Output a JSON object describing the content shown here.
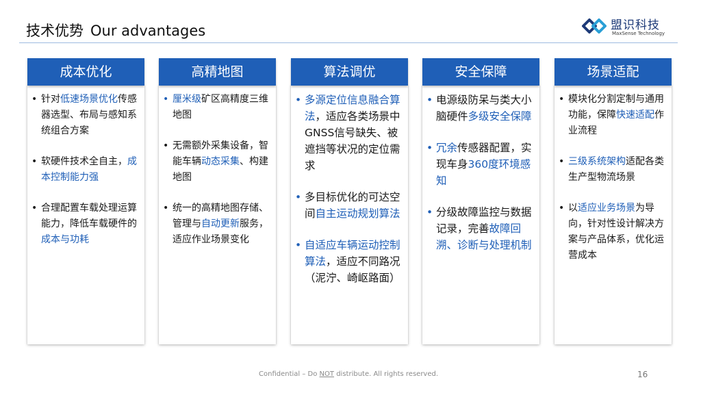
{
  "header": {
    "title_cn": "技术优势",
    "title_en": "Our advantages",
    "logo_cn": "盟识科技",
    "logo_en": "MaxSense Technology",
    "logo_color": "#1d3a78"
  },
  "columns": [
    {
      "title": "成本优化",
      "items": [
        {
          "parts": [
            {
              "t": "针对"
            },
            {
              "t": "低速场景优化",
              "hl": true
            },
            {
              "t": "传感器选型、布局与感知系统组合方案"
            }
          ]
        },
        {
          "parts": [
            {
              "t": "软硬件技术全自主，"
            },
            {
              "t": "成本控制能力强",
              "hl": true
            }
          ]
        },
        {
          "parts": [
            {
              "t": "合理配置车载处理运算能力，降低车载硬件的"
            },
            {
              "t": "成本与功耗",
              "hl": true
            }
          ]
        }
      ]
    },
    {
      "title": "高精地图",
      "items": [
        {
          "parts": [
            {
              "t": "厘米级",
              "hl": true
            },
            {
              "t": "矿区高精度三维地图"
            }
          ]
        },
        {
          "parts": [
            {
              "t": "无需额外采集设备，智能车辆"
            },
            {
              "t": "动态采集",
              "hl": true
            },
            {
              "t": "、构建地图"
            }
          ]
        },
        {
          "parts": [
            {
              "t": "统一的高精地图存储、管理与"
            },
            {
              "t": "自动更新",
              "hl": true
            },
            {
              "t": "服务，适应作业场景变化"
            }
          ]
        }
      ]
    },
    {
      "title": "算法调优",
      "items": [
        {
          "parts": [
            {
              "t": "多源定位信息融合算法",
              "hl": true
            },
            {
              "t": "，适应各类场景中GNSS信号缺失、被遮挡等状况的定位需求"
            }
          ]
        },
        {
          "parts": [
            {
              "t": "多目标优化的可达空间"
            },
            {
              "t": "自主运动规划算法",
              "hl": true
            }
          ]
        },
        {
          "parts": [
            {
              "t": "自适应车辆运动控制算法",
              "hl": true
            },
            {
              "t": "，适应不同路况（泥泞、崎岖路面）"
            }
          ]
        }
      ]
    },
    {
      "title": "安全保障",
      "items": [
        {
          "parts": [
            {
              "t": "电源级防呆与类大小脑硬件"
            },
            {
              "t": "多级安全保障",
              "hl": true
            }
          ]
        },
        {
          "parts": [
            {
              "t": "冗余",
              "hl": true
            },
            {
              "t": "传感器配置，实现车身"
            },
            {
              "t": "360度环境感知",
              "hl": true
            }
          ]
        },
        {
          "parts": [
            {
              "t": "分级故障监控与数据记录，完善"
            },
            {
              "t": "故障回溯、诊断与处理机制",
              "hl": true
            }
          ]
        }
      ]
    },
    {
      "title": "场景适配",
      "items": [
        {
          "parts": [
            {
              "t": "模块化分割定制与通用功能，保障"
            },
            {
              "t": "快速适配",
              "hl": true
            },
            {
              "t": "作业流程"
            }
          ]
        },
        {
          "parts": [
            {
              "t": "三级系统架构",
              "hl": true
            },
            {
              "t": "适配各类生产型物流场景"
            }
          ]
        },
        {
          "parts": [
            {
              "t": "以"
            },
            {
              "t": "适应业务场景",
              "hl": true
            },
            {
              "t": "为导向，针对性设计解决方案与产品体系，优化运营成本"
            }
          ]
        }
      ]
    }
  ],
  "footer": {
    "pre": "Confidential – Do ",
    "not": "NOT",
    "post": " distribute. All rights reserved.",
    "page": "16"
  },
  "colors": {
    "accent": "#1f5fb7",
    "highlight_text": "#1f5fb7"
  }
}
